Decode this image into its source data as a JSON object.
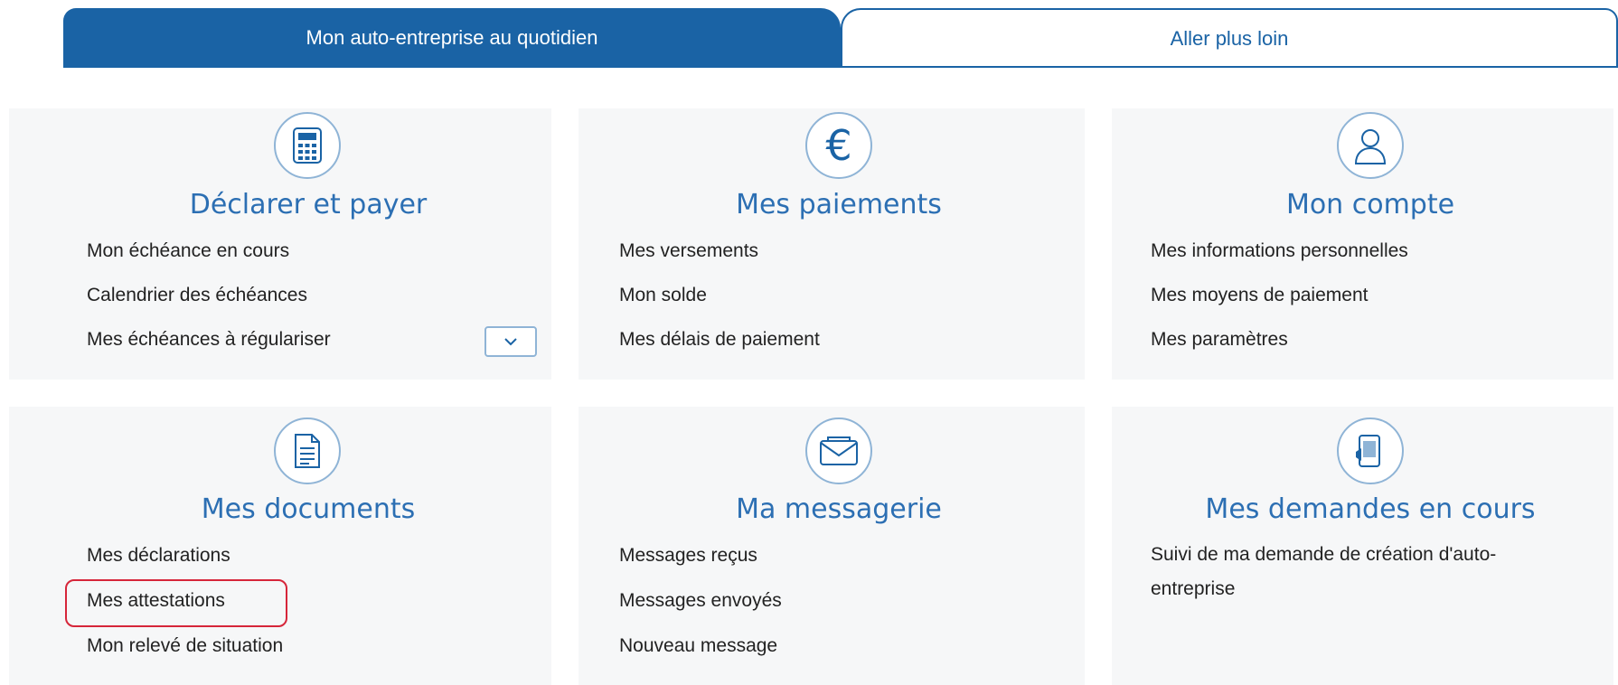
{
  "tabs": [
    {
      "label": "Mon auto-entreprise au quotidien",
      "active": true
    },
    {
      "label": "Aller plus loin",
      "active": false
    }
  ],
  "sections": {
    "declarer": {
      "title": "Déclarer et payer",
      "icon": "calculator-icon",
      "links": [
        "Mon échéance en cours",
        "Calendrier des échéances",
        "Mes échéances à régulariser"
      ]
    },
    "paiements": {
      "title": "Mes paiements",
      "icon": "euro-icon",
      "links": [
        "Mes versements",
        "Mon solde",
        "Mes délais de paiement"
      ]
    },
    "compte": {
      "title": "Mon compte",
      "icon": "user-icon",
      "links": [
        "Mes informations personnelles",
        "Mes moyens de paiement",
        "Mes paramètres"
      ]
    },
    "documents": {
      "title": "Mes documents",
      "icon": "document-icon",
      "links": [
        "Mes déclarations",
        "Mes attestations",
        "Mon relevé de situation"
      ]
    },
    "messagerie": {
      "title": "Ma messagerie",
      "icon": "envelope-icon",
      "links": [
        "Messages reçus",
        "Messages envoyés",
        "Nouveau message"
      ]
    },
    "demandes": {
      "title": "Mes demandes en cours",
      "icon": "mobile-request-icon",
      "links": [
        "Suivi de ma demande de création d'auto-entreprise"
      ]
    }
  },
  "colors": {
    "primary": "#1a63a5",
    "title": "#2c6fb3",
    "highlight": "#d6263a"
  }
}
